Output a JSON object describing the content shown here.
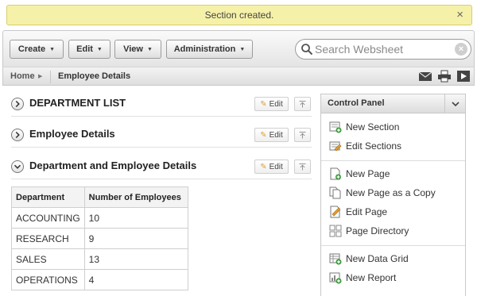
{
  "notification": {
    "message": "Section created.",
    "close_glyph": "×"
  },
  "toolbar": {
    "buttons": [
      {
        "label": "Create"
      },
      {
        "label": "Edit"
      },
      {
        "label": "View"
      },
      {
        "label": "Administration"
      }
    ],
    "search": {
      "placeholder": "Search Websheet",
      "value": ""
    }
  },
  "breadcrumb": {
    "home": "Home",
    "current": "Employee Details"
  },
  "header_icons": [
    "email-icon",
    "print-icon",
    "present-icon"
  ],
  "sections": [
    {
      "title": "DEPARTMENT LIST",
      "expanded": false,
      "edit_label": "Edit"
    },
    {
      "title": "Employee Details",
      "expanded": false,
      "edit_label": "Edit"
    },
    {
      "title": "Department and Employee Details",
      "expanded": true,
      "edit_label": "Edit"
    }
  ],
  "table": {
    "columns": [
      "Department",
      "Number of Employees"
    ],
    "rows": [
      [
        "ACCOUNTING",
        "10"
      ],
      [
        "RESEARCH",
        "9"
      ],
      [
        "SALES",
        "13"
      ],
      [
        "OPERATIONS",
        "4"
      ]
    ]
  },
  "control_panel": {
    "title": "Control Panel",
    "groups": [
      [
        "New Section",
        "Edit Sections"
      ],
      [
        "New Page",
        "New Page as a Copy",
        "Edit Page",
        "Page Directory"
      ],
      [
        "New Data Grid",
        "New Report"
      ]
    ]
  },
  "colors": {
    "notification_bg": "#f6f1a8",
    "accent_green": "#3a9a3a"
  }
}
